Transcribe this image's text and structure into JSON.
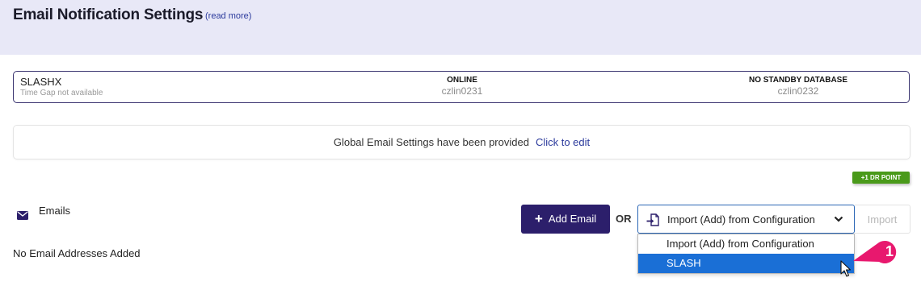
{
  "header": {
    "title": "Email Notification Settings",
    "read_more": "(read more)"
  },
  "database": {
    "name": "SLASHX",
    "time_gap": "Time Gap not available",
    "primary": {
      "status": "ONLINE",
      "host": "czlin0231"
    },
    "standby": {
      "status": "NO STANDBY DATABASE",
      "host": "czlin0232"
    }
  },
  "global_settings": {
    "text": "Global Email Settings have been provided",
    "edit_link": "Click to edit"
  },
  "dr_badge": "+1 DR POINT",
  "emails": {
    "label": "Emails",
    "empty_text": "No Email Addresses Added",
    "add_button": "Add Email",
    "or_label": "OR",
    "import_button": "Import"
  },
  "import_select": {
    "selected": "Import (Add) from Configuration",
    "options": [
      "Import (Add) from Configuration",
      "SLASH"
    ],
    "highlighted_index": 1
  },
  "callout": {
    "number": "1",
    "color": "#e8186e"
  },
  "colors": {
    "accent": "#2c1f6b",
    "link": "#2b3a9c",
    "badge": "#4a9a1a",
    "highlight": "#1a6fd6",
    "header_bg": "#e8e8f7"
  },
  "icons": {
    "mail": "envelope-icon",
    "import": "import-file-icon",
    "chevron": "chevron-down-icon",
    "cursor": "mouse-pointer-icon"
  }
}
